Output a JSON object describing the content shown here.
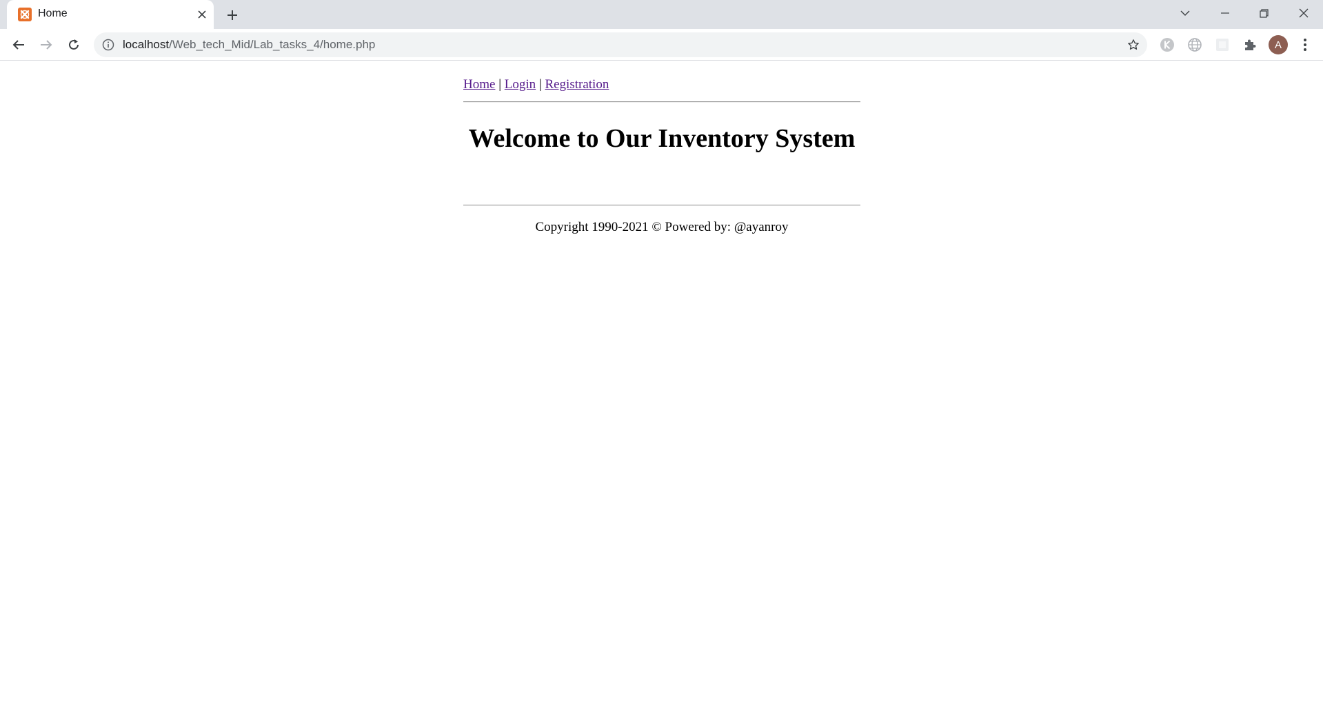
{
  "browser": {
    "tab": {
      "title": "Home",
      "favicon": "xampp-icon"
    },
    "address": {
      "host": "localhost",
      "path": "/Web_tech_Mid/Lab_tasks_4/home.php"
    },
    "profile_initial": "A",
    "colors": {
      "tabstrip": "#dee1e6",
      "omnibox": "#f1f3f4",
      "favicon": "#e8702a",
      "avatar": "#8d5e52"
    }
  },
  "page": {
    "nav": {
      "home": "Home",
      "separator1": "|",
      "login": "Login",
      "separator2": "|",
      "registration": "Registration"
    },
    "heading": "Welcome to Our Inventory System",
    "footer": "Copyright 1990-2021 © Powered by: @ayanroy",
    "colors": {
      "link": "#551a8b",
      "rule": "#9a9a9a"
    }
  }
}
